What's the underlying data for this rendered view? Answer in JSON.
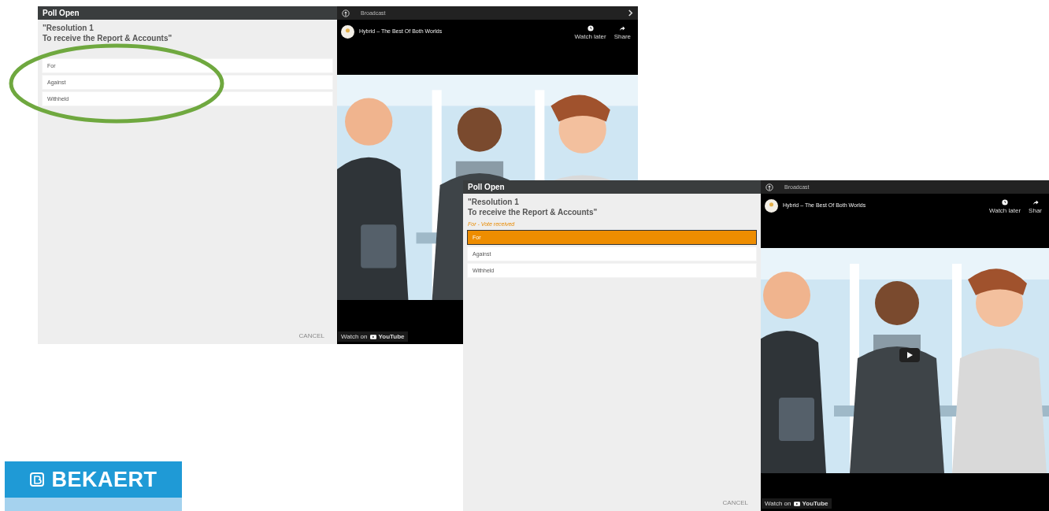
{
  "screenshots": [
    {
      "poll": {
        "title": "Poll Open",
        "question": [
          "\"Resolution 1",
          "To receive the Report & Accounts\""
        ],
        "options": [
          {
            "label": "For",
            "selected": false
          },
          {
            "label": "Against",
            "selected": false
          },
          {
            "label": "Withheld",
            "selected": false
          }
        ],
        "cancel": "CANCEL"
      },
      "video": {
        "header": "Broadcast",
        "title": "Hybrid – The Best Of Both Worlds",
        "watch_later": "Watch later",
        "share": "Share",
        "watch_on": "Watch on",
        "youtube": "YouTube",
        "play_button": false
      }
    },
    {
      "poll": {
        "title": "Poll Open",
        "question": [
          "\"Resolution 1",
          "To receive the Report & Accounts\""
        ],
        "status": "For - Vote received",
        "options": [
          {
            "label": "For",
            "selected": true
          },
          {
            "label": "Against",
            "selected": false
          },
          {
            "label": "Withheld",
            "selected": false
          }
        ],
        "cancel": "CANCEL"
      },
      "video": {
        "header": "Broadcast",
        "title": "Hybrid – The Best Of Both Worlds",
        "watch_later": "Watch later",
        "share": "Shar",
        "watch_on": "Watch on",
        "youtube": "YouTube",
        "play_button": true
      }
    }
  ],
  "logo": {
    "text": "BEKAERT"
  }
}
